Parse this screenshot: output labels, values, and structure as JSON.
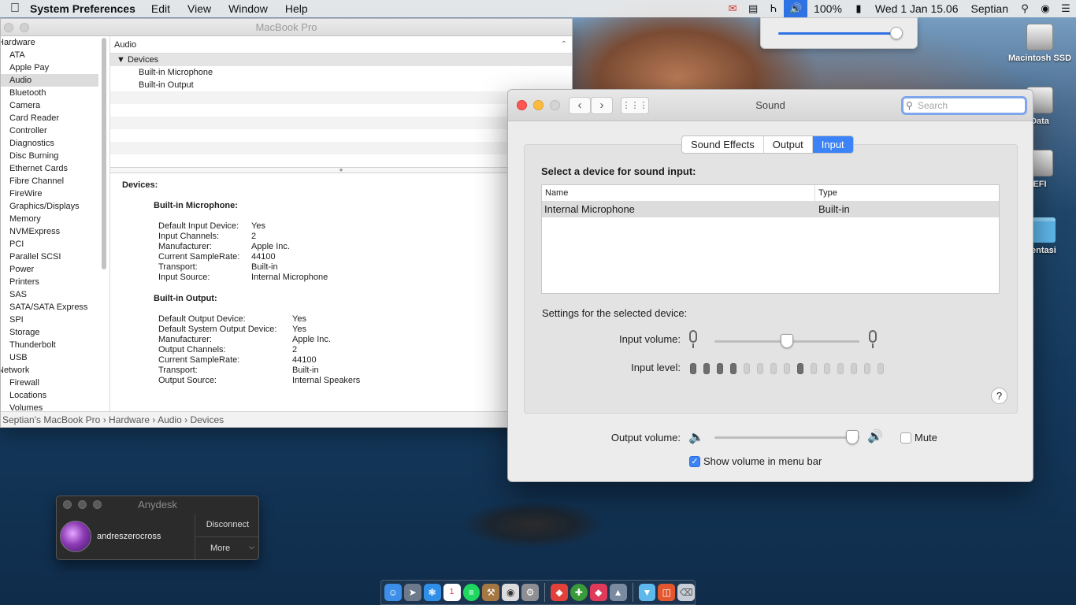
{
  "menubar": {
    "app_name": "System Preferences",
    "menus": [
      "Edit",
      "View",
      "Window",
      "Help"
    ],
    "battery": "100%",
    "datetime": "Wed 1 Jan  15.06",
    "user": "Septian"
  },
  "volume_popover": {
    "level": 0.95
  },
  "desktop_icons": {
    "macintosh_ssd": "Macintosh SSD",
    "data": "Data",
    "efi": "EFI",
    "folder": "mentasi"
  },
  "sysinfo": {
    "title": "MacBook Pro",
    "sidebar": {
      "hardware_group": "Hardware",
      "hardware_items": [
        "ATA",
        "Apple Pay",
        "Audio",
        "Bluetooth",
        "Camera",
        "Card Reader",
        "Controller",
        "Diagnostics",
        "Disc Burning",
        "Ethernet Cards",
        "Fibre Channel",
        "FireWire",
        "Graphics/Displays",
        "Memory",
        "NVMExpress",
        "PCI",
        "Parallel SCSI",
        "Power",
        "Printers",
        "SAS",
        "SATA/SATA Express",
        "SPI",
        "Storage",
        "Thunderbolt",
        "USB"
      ],
      "selected": "Audio",
      "network_group": "Network",
      "network_items": [
        "Firewall",
        "Locations",
        "Volumes"
      ]
    },
    "list_header": "Audio",
    "tree": {
      "parent": "Devices",
      "children": [
        "Built-in Microphone",
        "Built-in Output"
      ]
    },
    "detail": {
      "heading": "Devices:",
      "mic": {
        "title": "Built-in Microphone:",
        "rows": [
          {
            "k": "Default Input Device:",
            "v": "Yes"
          },
          {
            "k": "Input Channels:",
            "v": "2"
          },
          {
            "k": "Manufacturer:",
            "v": "Apple Inc."
          },
          {
            "k": "Current SampleRate:",
            "v": "44100"
          },
          {
            "k": "Transport:",
            "v": "Built-in"
          },
          {
            "k": "Input Source:",
            "v": "Internal Microphone"
          }
        ]
      },
      "output": {
        "title": "Built-in Output:",
        "rows": [
          {
            "k": "Default Output Device:",
            "v": "Yes"
          },
          {
            "k": "Default System Output Device:",
            "v": "Yes"
          },
          {
            "k": "Manufacturer:",
            "v": "Apple Inc."
          },
          {
            "k": "Output Channels:",
            "v": "2"
          },
          {
            "k": "Current SampleRate:",
            "v": "44100"
          },
          {
            "k": "Transport:",
            "v": "Built-in"
          },
          {
            "k": "Output Source:",
            "v": "Internal Speakers"
          }
        ]
      }
    },
    "pathbar": [
      "Septian's MacBook Pro",
      "Hardware",
      "Audio",
      "Devices"
    ]
  },
  "sound": {
    "title": "Sound",
    "search_placeholder": "Search",
    "tabs": [
      {
        "label": "Sound Effects",
        "active": false
      },
      {
        "label": "Output",
        "active": false
      },
      {
        "label": "Input",
        "active": true
      }
    ],
    "select_heading": "Select a device for sound input:",
    "table": {
      "col_name": "Name",
      "col_type": "Type",
      "rows": [
        {
          "name": "Internal Microphone",
          "type": "Built-in"
        }
      ]
    },
    "settings_label": "Settings for the selected device:",
    "input_volume_label": "Input volume:",
    "input_volume": 0.5,
    "input_level_label": "Input level:",
    "input_level_bars": [
      1,
      1,
      1,
      1,
      0,
      0,
      0,
      0,
      1,
      0,
      0,
      0,
      0,
      0,
      0
    ],
    "help": "?",
    "output_volume_label": "Output volume:",
    "output_volume": 0.95,
    "mute_label": "Mute",
    "mute_checked": false,
    "show_volume_label": "Show volume in menu bar",
    "show_volume_checked": true
  },
  "anydesk": {
    "title": "Anydesk",
    "user": "andreszerocross",
    "disconnect": "Disconnect",
    "more": "More"
  },
  "colors": {
    "accent": "#3b83f7",
    "close": "#fc5753",
    "minimize": "#fdbc40"
  }
}
